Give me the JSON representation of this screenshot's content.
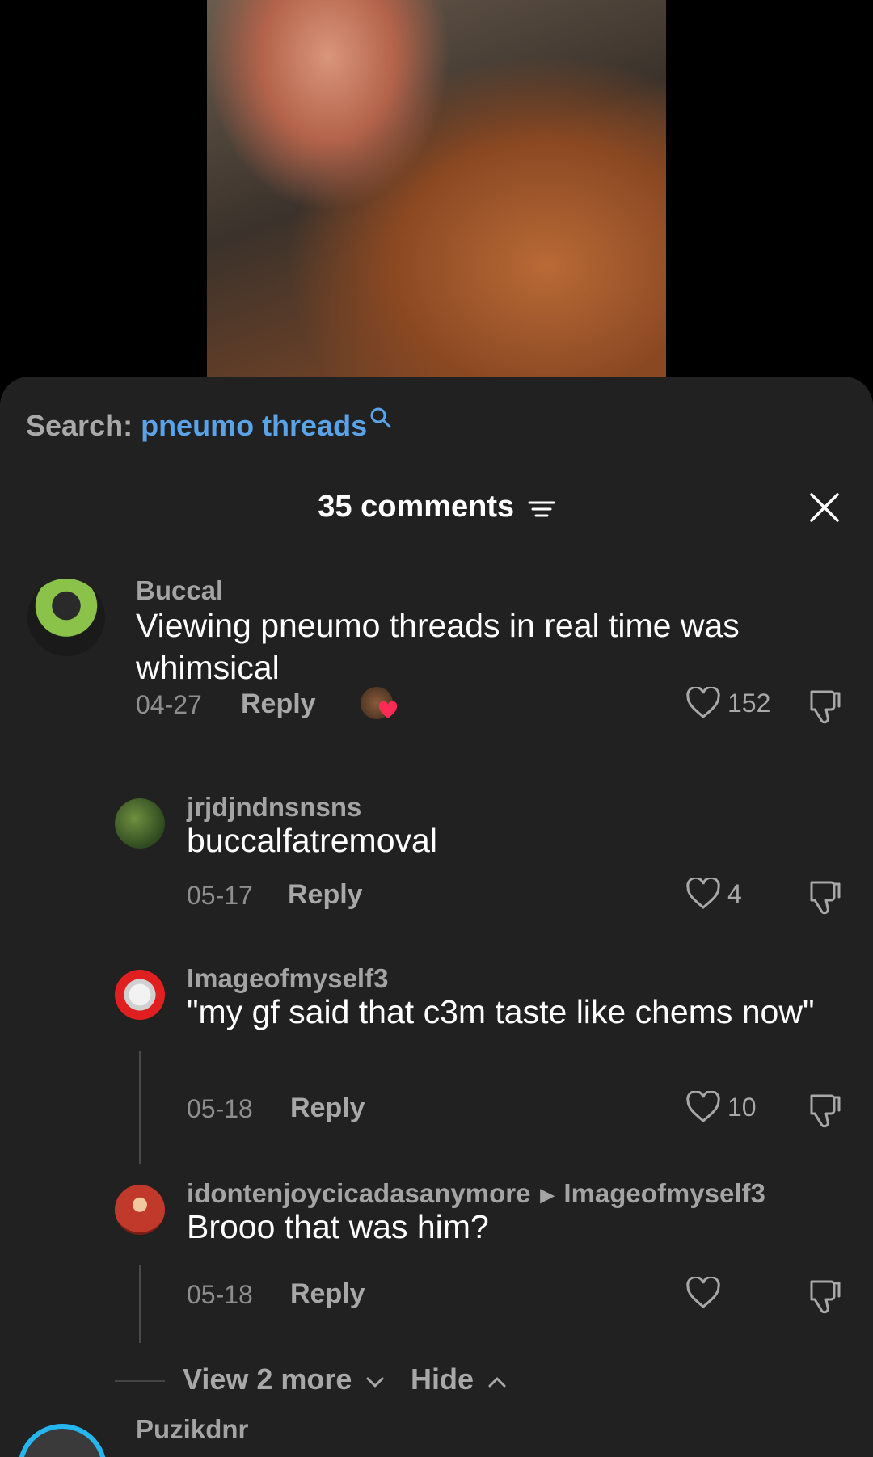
{
  "search": {
    "prefix": "Search:",
    "term": "pneumo threads"
  },
  "header": {
    "comment_count": "35 comments"
  },
  "comments": [
    {
      "username": "Buccal",
      "text": "Viewing pneumo threads in real time was whimsical",
      "date": "04-27",
      "reply_label": "Reply",
      "likes": "152"
    }
  ],
  "replies": [
    {
      "username": "jrjdjndnsnsns",
      "text": "buccalfatremoval",
      "date": "05-17",
      "reply_label": "Reply",
      "likes": "4"
    },
    {
      "username": "Imageofmyself3",
      "text": "\"my gf said that c3m taste like chems now\"",
      "date": "05-18",
      "reply_label": "Reply",
      "likes": "10"
    },
    {
      "username": "idontenjoycicadasanymore",
      "reply_to": "Imageofmyself3",
      "text": "Brooo that was him?",
      "date": "05-18",
      "reply_label": "Reply",
      "likes": ""
    }
  ],
  "thread_controls": {
    "view_more": "View 2 more",
    "hide": "Hide"
  },
  "next_comment": {
    "username": "Puzikdnr"
  },
  "colors": {
    "accent": "#5ba3e8",
    "sheet_bg": "#212121",
    "creator_ring": "#25b6f0"
  }
}
